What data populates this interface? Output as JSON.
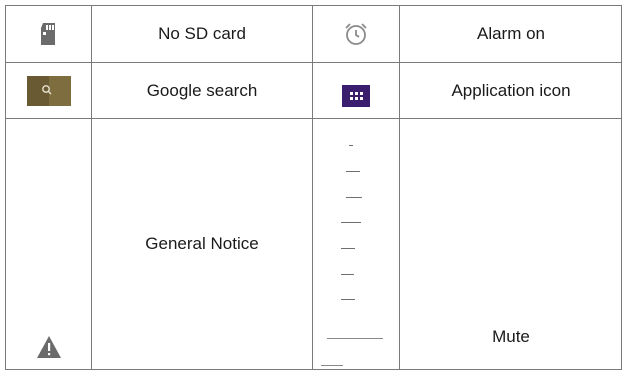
{
  "rows": [
    {
      "left_label": "No SD card",
      "right_label": "Alarm on"
    },
    {
      "left_label": "Google search",
      "right_label": "Application icon"
    },
    {
      "left_label": "General Notice",
      "right_label": "Mute"
    }
  ],
  "icons": {
    "r1_left": "sd-card-icon",
    "r1_right": "alarm-clock-icon",
    "r2_left": "search-icon",
    "r2_right": "apps-grid-icon",
    "r3_left": "warning-icon",
    "r3_right": "mute-icon"
  },
  "colors": {
    "border": "#7a7a7a",
    "icon_gray": "#6b6b6b",
    "search_bg": "#6a5a34",
    "apps_bg": "#3b1f6e"
  }
}
